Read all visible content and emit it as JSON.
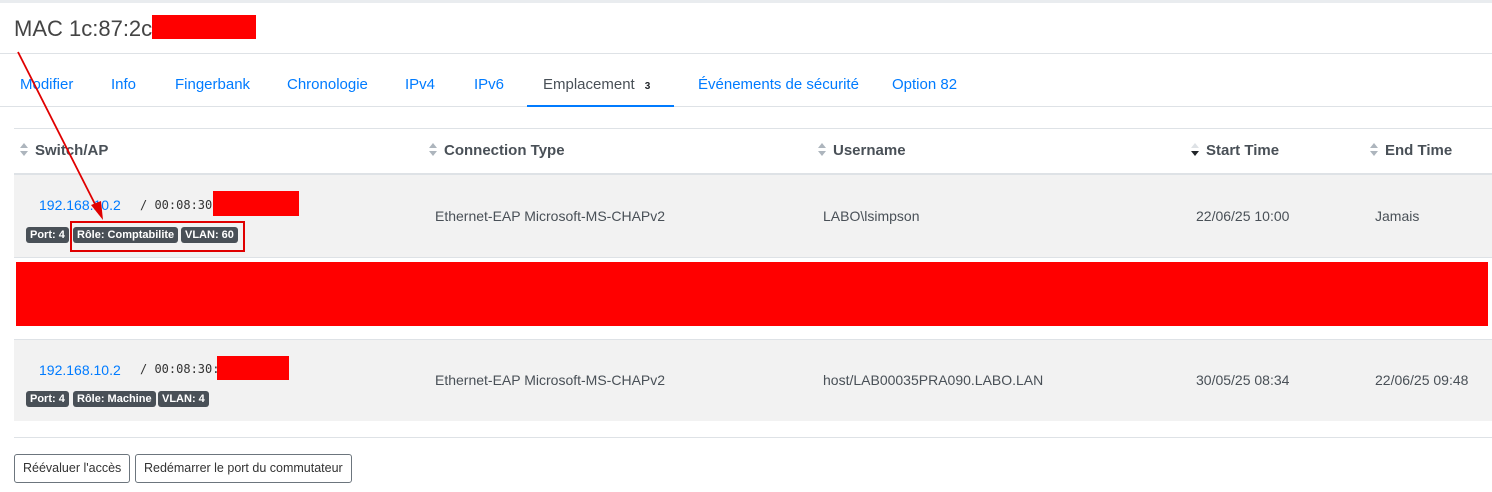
{
  "header": {
    "title": "MAC 1c:87:2c"
  },
  "tabs": [
    {
      "label": "Modifier"
    },
    {
      "label": "Info"
    },
    {
      "label": "Fingerbank"
    },
    {
      "label": "Chronologie"
    },
    {
      "label": "IPv4"
    },
    {
      "label": "IPv6"
    },
    {
      "label": "Emplacement",
      "count": "3"
    },
    {
      "label": "Événements de sécurité"
    },
    {
      "label": "Option 82"
    }
  ],
  "table": {
    "columns": [
      "Switch/AP",
      "Connection Type",
      "Username",
      "Start Time",
      "End Time"
    ],
    "rows": [
      {
        "ip": "192.168.10.2",
        "mac": "/ 00:08:30:",
        "badges": [
          "Port: 4",
          "Rôle: Comptabilite",
          "VLAN: 60"
        ],
        "connection_type": "Ethernet-EAP Microsoft-MS-CHAPv2",
        "username": "LABO\\lsimpson",
        "start_time": "22/06/25 10:00",
        "end_time": "Jamais"
      },
      {
        "ip": "192.168.10.2",
        "mac": "/ 00:08:30:",
        "badges": [
          "Port: 4",
          "Rôle: Machine",
          "VLAN: 4"
        ],
        "connection_type": "Ethernet-EAP Microsoft-MS-CHAPv2",
        "username": "host/LAB00035PRA090.LABO.LAN",
        "start_time": "30/05/25 08:34",
        "end_time": "22/06/25 09:48"
      }
    ]
  },
  "actions": {
    "reevaluate": "Réévaluer l'accès",
    "restart_port": "Redémarrer le port du commutateur"
  },
  "colors": {
    "link": "#007bff",
    "badge": "#495057",
    "redaction": "#ff0000",
    "annotation": "#e00000"
  }
}
